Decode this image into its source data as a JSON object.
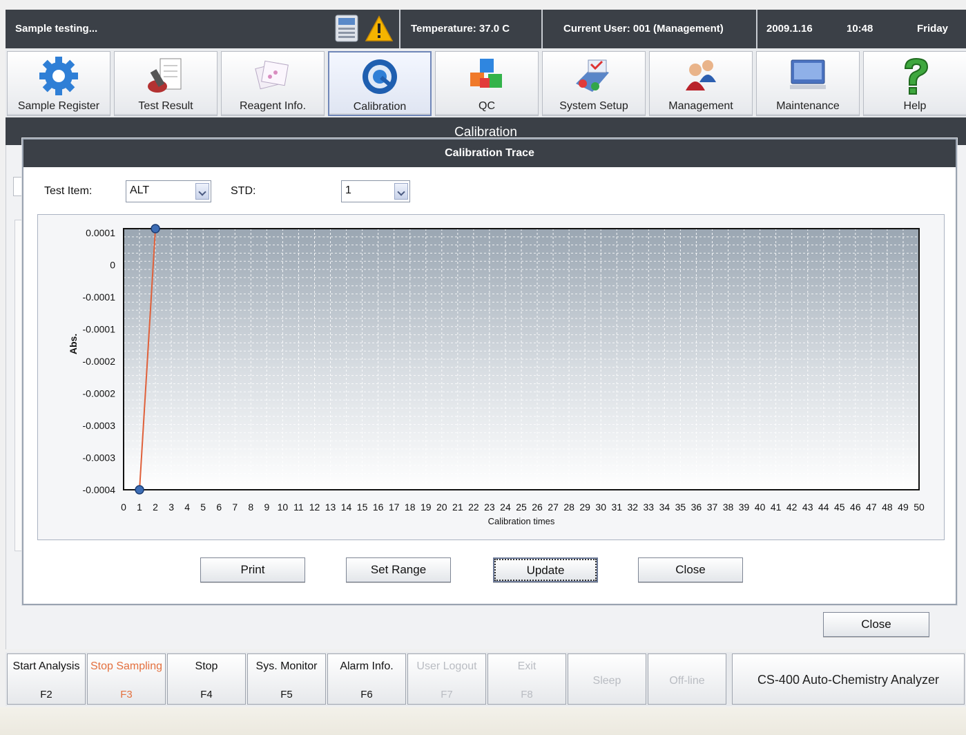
{
  "status": {
    "state": "Sample testing...",
    "temperature": "Temperature: 37.0 C",
    "current_user": "Current User: 001  (Management)",
    "date": "2009.1.16",
    "time": "10:48",
    "weekday": "Friday"
  },
  "toolbar": {
    "items": [
      {
        "label": "Sample Register",
        "icon": "gear-icon"
      },
      {
        "label": "Test Result",
        "icon": "test-result-icon"
      },
      {
        "label": "Reagent Info.",
        "icon": "reagent-icon"
      },
      {
        "label": "Calibration",
        "icon": "calibration-icon"
      },
      {
        "label": "QC",
        "icon": "qc-cubes-icon"
      },
      {
        "label": "System Setup",
        "icon": "system-setup-icon"
      },
      {
        "label": "Management",
        "icon": "users-icon"
      },
      {
        "label": "Maintenance",
        "icon": "monitor-icon"
      },
      {
        "label": "Help",
        "icon": "question-icon"
      }
    ],
    "active": "Calibration"
  },
  "page": {
    "title": "Calibration"
  },
  "dialog": {
    "title": "Calibration Trace",
    "test_item_label": "Test Item:",
    "test_item_value": "ALT",
    "std_label": "STD:",
    "std_value": "1",
    "buttons": {
      "print": "Print",
      "set_range": "Set Range",
      "update": "Update",
      "close": "Close"
    }
  },
  "outer_close": "Close",
  "fkeys": [
    {
      "label": "Start Analysis",
      "key": "F2",
      "state": "normal"
    },
    {
      "label": "Stop Sampling",
      "key": "F3",
      "state": "alert"
    },
    {
      "label": "Stop",
      "key": "F4",
      "state": "normal"
    },
    {
      "label": "Sys. Monitor",
      "key": "F5",
      "state": "normal"
    },
    {
      "label": "Alarm Info.",
      "key": "F6",
      "state": "normal"
    },
    {
      "label": "User Logout",
      "key": "F7",
      "state": "disabled"
    },
    {
      "label": "Exit",
      "key": "F8",
      "state": "disabled"
    },
    {
      "label": "Sleep",
      "key": "",
      "state": "disabled"
    },
    {
      "label": "Off-line",
      "key": "",
      "state": "disabled"
    }
  ],
  "product_name": "CS-400 Auto-Chemistry Analyzer",
  "colors": {
    "dark_bar": "#3b4047",
    "trace_line": "#e0603a",
    "point": "#3d6db5",
    "alert_text": "#e4703e"
  },
  "chart_data": {
    "type": "line",
    "xlabel": "Calibration times",
    "ylabel": "Abs.",
    "xlim": [
      0,
      50
    ],
    "x_ticks": [
      0,
      1,
      2,
      3,
      4,
      5,
      6,
      7,
      8,
      9,
      10,
      11,
      12,
      13,
      14,
      15,
      16,
      17,
      18,
      19,
      20,
      21,
      22,
      23,
      24,
      25,
      26,
      27,
      28,
      29,
      30,
      31,
      32,
      33,
      34,
      35,
      36,
      37,
      38,
      39,
      40,
      41,
      42,
      43,
      44,
      45,
      46,
      47,
      48,
      49,
      50
    ],
    "y_tick_labels": [
      "0.0001",
      "0",
      "-0.0001",
      "-0.0001",
      "-0.0002",
      "-0.0002",
      "-0.0003",
      "-0.0003",
      "-0.0004"
    ],
    "y_tick_values": [
      0.0001,
      0.0,
      -5e-05,
      -0.0001,
      -0.00015,
      -0.0002,
      -0.00025,
      -0.0003,
      -0.0004
    ],
    "ylim": [
      -0.0004,
      0.0001
    ],
    "grid": true,
    "series": [
      {
        "x": [
          1,
          2
        ],
        "y": [
          -0.0004,
          0.0001
        ]
      }
    ]
  }
}
